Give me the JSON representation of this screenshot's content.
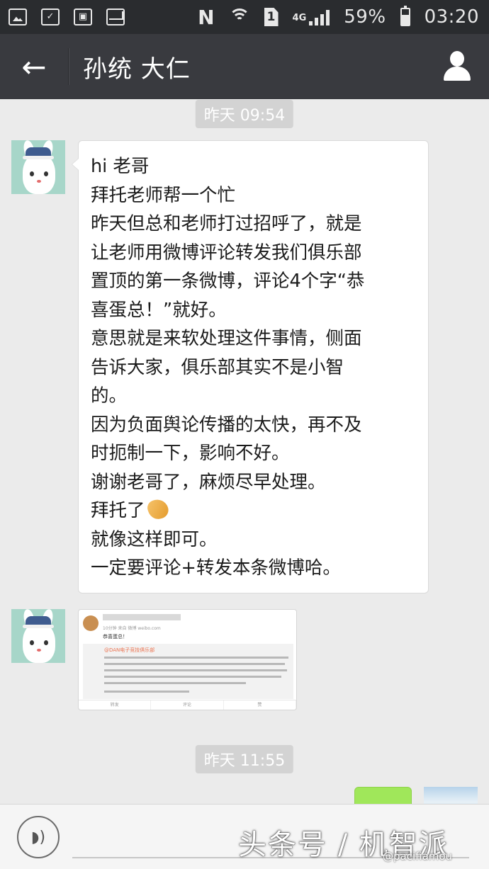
{
  "status_bar": {
    "battery_text": "59%",
    "time": "03:20",
    "network": "4G",
    "sim": "1",
    "nfc": "N"
  },
  "header": {
    "title": "孙统 大仁",
    "back_icon": "arrow-left-icon",
    "profile_icon": "person-icon"
  },
  "timestamps": [
    "昨天 09:54",
    "昨天 11:55"
  ],
  "message": {
    "lines": [
      "hi 老哥",
      "拜托老师帮一个忙",
      "昨天但总和老师打过招呼了，就是",
      "让老师用微博评论转发我们俱乐部",
      "置顶的第一条微博，评论4个字“恭",
      "喜蛋总！”就好。",
      "意思就是来软处理这件事情，侧面",
      "告诉大家，俱乐部其实不是小智",
      "的。",
      "因为负面舆论传播的太快，再不及",
      "时扼制一下，影响不好。",
      "谢谢老哥了，麻烦尽早处理。",
      "拜托了",
      "就像这样即可。",
      "一定要评论+转发本条微博哈。"
    ]
  },
  "image_message": {
    "comment": "恭喜蛋总！",
    "meta": "10分钟 来自 微博 weibo.com",
    "repost_name": "@DAN电子竞技俱乐部",
    "actions": [
      "转发",
      "评论",
      "赞"
    ]
  },
  "watermark": {
    "text": "头条号 / 机智派",
    "sub": "@pacifiamou"
  },
  "colors": {
    "status_bg": "#2a2c2f",
    "header_bg": "#393a3f",
    "chat_bg": "#ebebeb",
    "sent_bubble": "#a0e75a"
  }
}
